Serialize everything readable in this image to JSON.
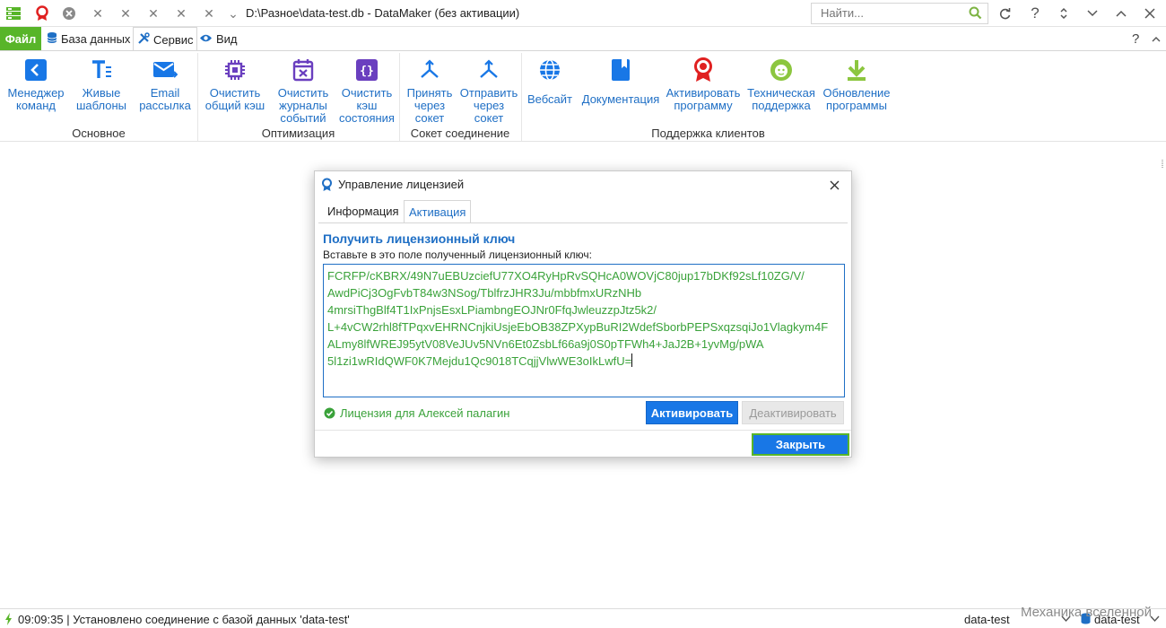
{
  "titlebar": {
    "title": "D:\\Разное\\data-test.db - DataMaker (без активации)",
    "search_placeholder": "Найти...",
    "quick_access": [
      "app-menu-icon",
      "license-icon",
      "close-circle-icon",
      "close-icon",
      "close-icon",
      "close-icon",
      "close-icon",
      "close-icon",
      "chevron-down-icon"
    ],
    "window_buttons": [
      "refresh-icon",
      "help-icon",
      "expand-icon",
      "chevron-down-icon",
      "chevron-up-icon",
      "close-icon"
    ]
  },
  "tabs": {
    "file": "Файл",
    "databases": "База данных",
    "service": "Сервис",
    "view": "Вид",
    "help": "?"
  },
  "ribbon": {
    "groups": {
      "main": "Основное",
      "optimization": "Оптимизация",
      "socket": "Сокет соединение",
      "support": "Поддержка клиентов"
    },
    "buttons": {
      "command_manager": "Менеджер\nкоманд",
      "live_templates": "Живые\nшаблоны",
      "email": "Email\nрассылка",
      "clear_cache": "Очистить\nобщий кэш",
      "clear_logs": "Очистить\nжурналы\nсобытий",
      "clear_state": "Очистить\nкэш\nсостояния",
      "receive_socket": "Принять\nчерез\nсокет",
      "send_socket": "Отправить\nчерез\nсокет",
      "website": "Вебсайт",
      "docs": "Документация",
      "activate": "Активировать\nпрограмму",
      "tech_support": "Техническая\nподдержка",
      "update": "Обновление\nпрограммы"
    }
  },
  "dialog": {
    "title": "Управление лицензией",
    "tab_info": "Информация",
    "tab_activation": "Активация",
    "section_title": "Получить лицензионный ключ",
    "hint": "Вставьте в это поле полученный лицензионный ключ:",
    "key": "FCRFP/cKBRX/49N7uEBUzciefU77XO4RyHpRvSQHcA0WOVjC80jup17bDKf92sLf10ZG/V/\nAwdPiCj3OgFvbT84w3NSog/TblfrzJHR3Ju/mbbfmxURzNHb\n4mrsiThgBlf4T1IxPnjsEsxLPiambngEOJNr0FfqJwleuzzpJtz5k2/\nL+4vCW2rhl8fTPqxvEHRNCnjkiUsjeEbOB38ZPXypBuRI2WdefSborbPEPSxqzsqiJo1Vlagkym4F\nALmy8lfWREJ95ytV08VeJUv5NVn6Et0ZsbLf66a9j0S0pTFWh4+JaJ2B+1yvMg/pWA\n5l1zi1wRIdQWF0K7Mejdu1Qc9018TCqjjVlwWE3oIkLwfU=",
    "license_status": "Лицензия для Алексей палагин",
    "activate_button": "Активировать",
    "deactivate_button": "Деактивировать",
    "close_button": "Закрыть"
  },
  "statusbar": {
    "message": "09:09:35 | Установлено соединение с базой данных 'data-test'",
    "db_name": "data-test",
    "db_name_right": "data-test"
  },
  "watermark": "Механика вселенной",
  "colors": {
    "accent_green": "#58b529",
    "accent_blue": "#1f6fc5",
    "button_blue": "#1877e6",
    "key_text": "#3aa23a",
    "ribbon_purple": "#6a3fbf",
    "ribbon_red": "#e02020",
    "ribbon_lime": "#8cc63f"
  }
}
